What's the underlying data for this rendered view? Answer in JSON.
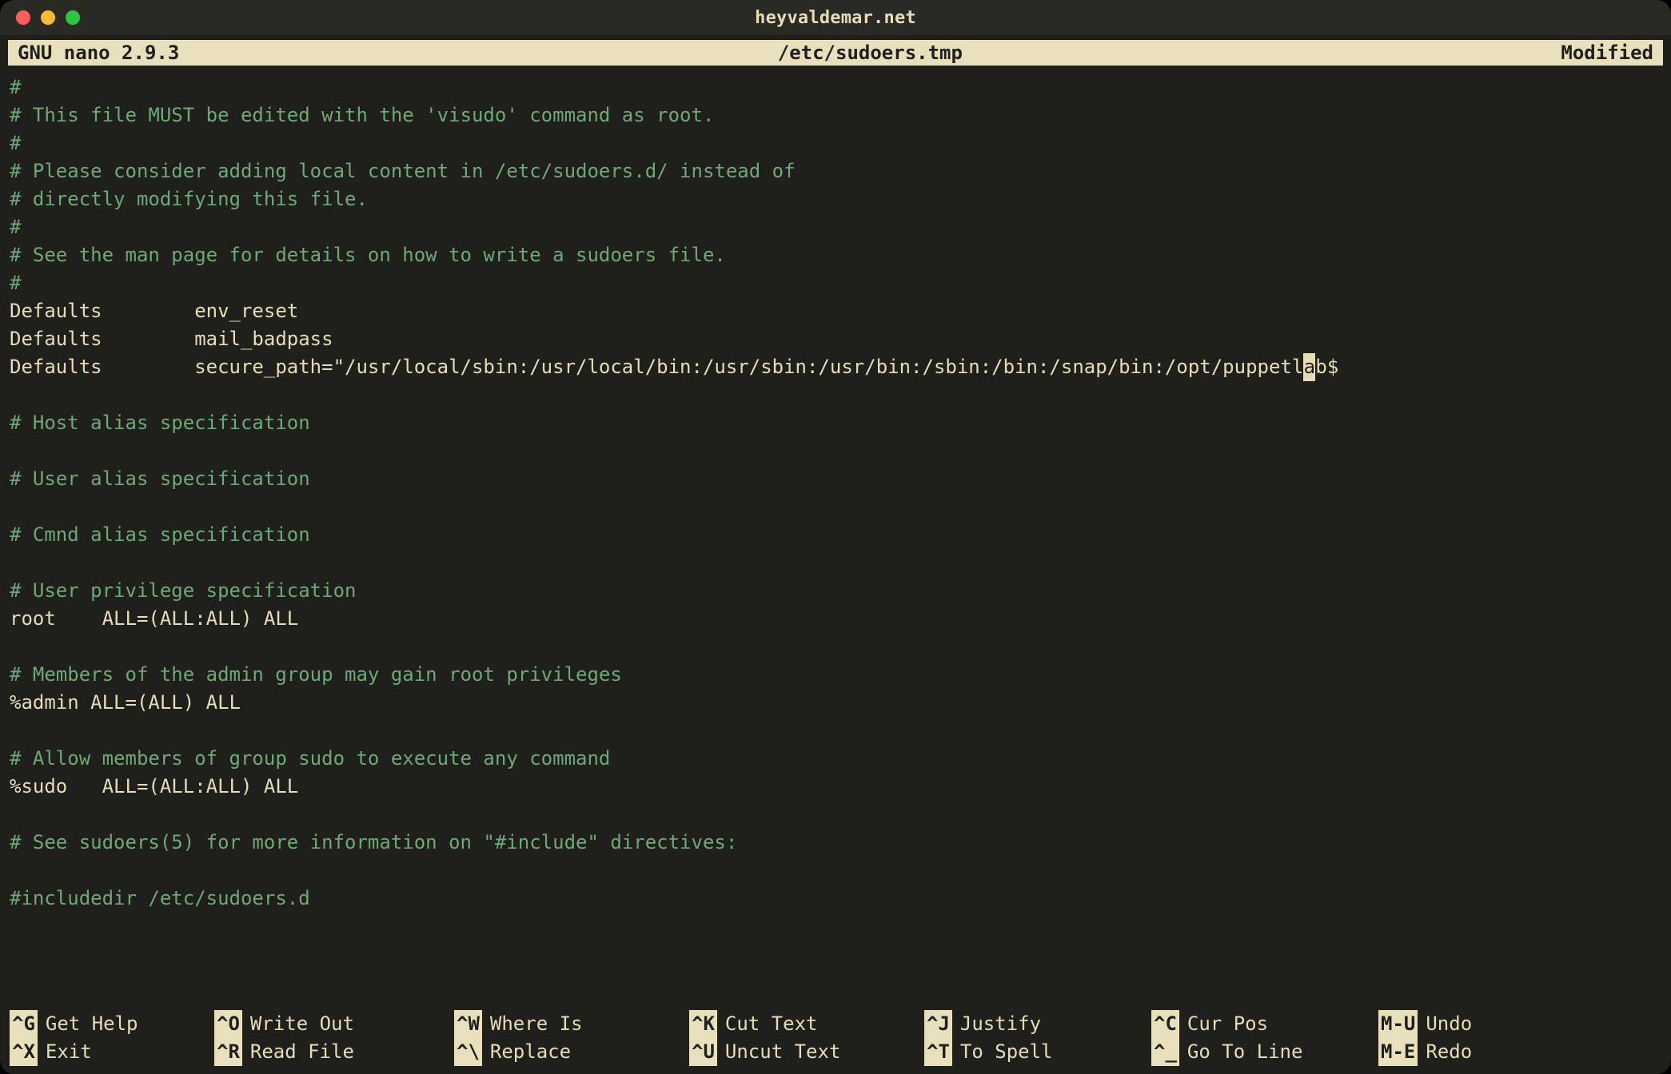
{
  "window": {
    "title": "heyvaldemar.net"
  },
  "status": {
    "app": "GNU nano 2.9.3",
    "file": "/etc/sudoers.tmp",
    "state": "Modified"
  },
  "colors": {
    "bg": "#1f201b",
    "fg": "#e6ddb8",
    "comment": "#6fa877",
    "inverse_bg": "#e8dfbc"
  },
  "lines": [
    {
      "t": "comment",
      "s": "#"
    },
    {
      "t": "comment",
      "s": "# This file MUST be edited with the 'visudo' command as root."
    },
    {
      "t": "comment",
      "s": "#"
    },
    {
      "t": "comment",
      "s": "# Please consider adding local content in /etc/sudoers.d/ instead of"
    },
    {
      "t": "comment",
      "s": "# directly modifying this file."
    },
    {
      "t": "comment",
      "s": "#"
    },
    {
      "t": "comment",
      "s": "# See the man page for details on how to write a sudoers file."
    },
    {
      "t": "comment",
      "s": "#"
    },
    {
      "t": "text",
      "s": "Defaults        env_reset"
    },
    {
      "t": "text",
      "s": "Defaults        mail_badpass"
    },
    {
      "t": "secure",
      "pre": "Defaults        secure_path=\"/usr/local/sbin:/usr/local/bin:/usr/sbin:/usr/bin:/sbin:/bin:/snap/bin:/opt/puppetl",
      "cursor": "a",
      "post": "b$"
    },
    {
      "t": "blank",
      "s": ""
    },
    {
      "t": "comment",
      "s": "# Host alias specification"
    },
    {
      "t": "blank",
      "s": ""
    },
    {
      "t": "comment",
      "s": "# User alias specification"
    },
    {
      "t": "blank",
      "s": ""
    },
    {
      "t": "comment",
      "s": "# Cmnd alias specification"
    },
    {
      "t": "blank",
      "s": ""
    },
    {
      "t": "comment",
      "s": "# User privilege specification"
    },
    {
      "t": "text",
      "s": "root    ALL=(ALL:ALL) ALL"
    },
    {
      "t": "blank",
      "s": ""
    },
    {
      "t": "comment",
      "s": "# Members of the admin group may gain root privileges"
    },
    {
      "t": "text",
      "s": "%admin ALL=(ALL) ALL"
    },
    {
      "t": "blank",
      "s": ""
    },
    {
      "t": "comment",
      "s": "# Allow members of group sudo to execute any command"
    },
    {
      "t": "text",
      "s": "%sudo   ALL=(ALL:ALL) ALL"
    },
    {
      "t": "blank",
      "s": ""
    },
    {
      "t": "comment",
      "s": "# See sudoers(5) for more information on \"#include\" directives:"
    },
    {
      "t": "blank",
      "s": ""
    },
    {
      "t": "comment",
      "s": "#includedir /etc/sudoers.d"
    }
  ],
  "shortcuts": {
    "row1": [
      {
        "key": "^G",
        "label": "Get Help"
      },
      {
        "key": "^O",
        "label": "Write Out"
      },
      {
        "key": "^W",
        "label": "Where Is"
      },
      {
        "key": "^K",
        "label": "Cut Text"
      },
      {
        "key": "^J",
        "label": "Justify"
      },
      {
        "key": "^C",
        "label": "Cur Pos"
      },
      {
        "key": "M-U",
        "label": "Undo"
      }
    ],
    "row2": [
      {
        "key": "^X",
        "label": "Exit"
      },
      {
        "key": "^R",
        "label": "Read File"
      },
      {
        "key": "^\\",
        "label": "Replace"
      },
      {
        "key": "^U",
        "label": "Uncut Text"
      },
      {
        "key": "^T",
        "label": "To Spell"
      },
      {
        "key": "^_",
        "label": "Go To Line"
      },
      {
        "key": "M-E",
        "label": "Redo"
      }
    ]
  }
}
